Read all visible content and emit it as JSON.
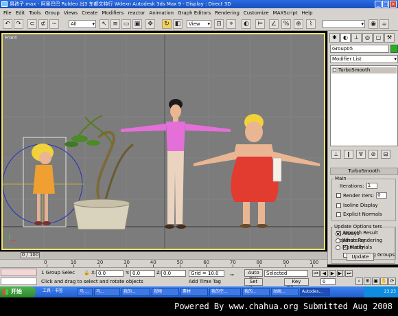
{
  "window": {
    "title": "男孩子.max    - 阿里巴巴 Ruldeo 出3 东都文特行 Wdexn  Autodesk 3ds Max 9        - Display : Direct 3D"
  },
  "menubar": {
    "items": [
      "File",
      "Edit",
      "Tools",
      "Group",
      "Views",
      "Create",
      "Modifiers",
      "reactor",
      "Animation",
      "Graph Editors",
      "Rendering",
      "Customize",
      "MAXScript",
      "Help"
    ]
  },
  "toolbar": {
    "selection_filter": "All",
    "ref_coord": "View"
  },
  "viewport": {
    "label": "Front"
  },
  "command_panel": {
    "object_name": "Group05",
    "modifier_list": "Modifier List",
    "stack_item": "TurboSmooth",
    "rollout_title": "TurboSmooth",
    "main": {
      "label": "Main",
      "iterations_label": "Iterations:",
      "iterations": "1",
      "render_iters_label": "Render Iters:",
      "render_iters": "0",
      "isoline_display": "Isoline Display",
      "explicit_normals": "Explicit Normals"
    },
    "surface": {
      "label": "Surface Parameters",
      "smooth_result": "Smooth Result",
      "separate_by": "Separate by:",
      "materials": "Materials",
      "smoothing_groups": "Smoothing Groups"
    },
    "update": {
      "label": "Update Options",
      "always": "Always",
      "when_rendering": "When Rendering",
      "manually": "Manually",
      "update_button": "Update"
    }
  },
  "timeline": {
    "slider": "0 / 100",
    "ticks": [
      "0",
      "10",
      "20",
      "30",
      "40",
      "50",
      "60",
      "70",
      "80",
      "90",
      "100"
    ],
    "progress": 0
  },
  "status": {
    "group_selected": "1 Group Selec",
    "prompt": "Click and drag to select and rotate objects",
    "x_label": "X:",
    "x": "0.0",
    "y_label": "Y:",
    "y": "0.0",
    "z_label": "Z:",
    "z": "0.0",
    "grid": "Grid = 10.0",
    "add_time_tag": "Add Time Tag",
    "auto_key": "Auto Key",
    "set_key": "Set Key",
    "key_mode": "Selected",
    "key_filters": "Key Filters...",
    "frame": "0"
  },
  "taskbar": {
    "start": "开始",
    "tools": "工具 · 书签",
    "tasks": [
      "马 ...",
      "马...",
      "我的...",
      "视频",
      "素材",
      "我的空...",
      "我的...",
      "动画...",
      "Autodes..."
    ],
    "clock": "23:23"
  },
  "footer": {
    "text": "Powered By www.chahua.org  Submitted Aug 2008"
  },
  "colors": {
    "viewport_border": "#f3e26a",
    "object_color": "#1db51d",
    "taskbar": "#225ed0"
  }
}
